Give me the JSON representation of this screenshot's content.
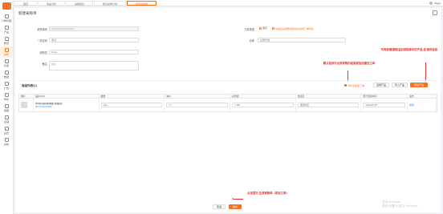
{
  "sidebar": {
    "items": [
      {
        "label": "订单管理",
        "icon": "orders-icon"
      },
      {
        "label": "产品",
        "icon": "product-icon"
      },
      {
        "label": "物流",
        "icon": "logistics-icon"
      },
      {
        "label": "采购",
        "icon": "purchase-icon",
        "active": true
      },
      {
        "label": "仓库",
        "icon": "warehouse-icon"
      },
      {
        "label": "数据",
        "icon": "data-icon"
      },
      {
        "label": "广告",
        "icon": "ads-icon"
      },
      {
        "label": "财务",
        "icon": "finance-icon"
      },
      {
        "label": "客服",
        "icon": "service-icon"
      },
      {
        "label": "店铺",
        "icon": "store-icon"
      },
      {
        "label": "设置",
        "icon": "settings-icon"
      },
      {
        "label": "系统",
        "icon": "system-icon"
      }
    ]
  },
  "topbar": {
    "tabs": [
      {
        "label": "首页"
      },
      {
        "label": "商品分析"
      },
      {
        "label": "采购建议"
      },
      {
        "label": "建议采购计划"
      },
      {
        "label": "新建采购单",
        "active": true
      }
    ],
    "user": "Mega"
  },
  "form": {
    "title": "新建采购单",
    "order_no_label": "采购单号",
    "order_no_value": "CG20230615000001",
    "supplier_label": "* 供应商",
    "supplier_value": "测试",
    "buyer_label": "采购员",
    "buyer_value": "bingo",
    "remark_label": "备注",
    "remark_placeholder": "备注",
    "order_type_label": "订单类型",
    "order_type_value": "库存",
    "order_type_hint": "勾选后采购数量自动生成到下单列表",
    "warehouse_label": "仓库",
    "warehouse_value": "全部仓储"
  },
  "products": {
    "section_title": "商品列表(1)",
    "sync_checkbox_label": "同步生成加工单",
    "btn_select": "选择产品",
    "btn_import": "导入产品",
    "btn_add": "添加产品",
    "columns": [
      "图片",
      "品名/SKU",
      "数量",
      "单价",
      "总金额",
      "供应商",
      "预计到货时间",
      "操作"
    ],
    "rows": [
      {
        "name": "中冲切割圆珠球面环抱面养...",
        "sku": "65741/SKU2326",
        "qty": "100",
        "price": "7.7",
        "total": "7,100",
        "supplier": "测试供应",
        "eta": "2023-06-15",
        "action": "删除"
      }
    ]
  },
  "footer": {
    "cancel": "取消",
    "submit": "提交"
  },
  "annotations": {
    "checkbox_note": "默认选择为全部采购的组装或加创建加工单",
    "add_note": "可再新增/删除当前采购单中的产品 或 修改信息",
    "submit_note": "点击提交 生成采购单（和加工单）"
  },
  "watermark": {
    "line1": "激活 Windows",
    "line2": "转到“设置”以激活 Windows。"
  },
  "colors": {
    "accent": "#f5721f",
    "annotation": "#e8322b",
    "link": "#1890ff"
  }
}
